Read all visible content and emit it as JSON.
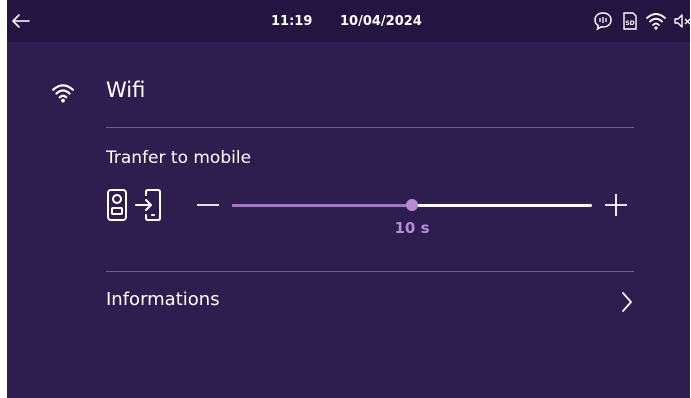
{
  "status_bar": {
    "time": "11:19",
    "date": "10/04/2024",
    "icons": [
      "back-arrow-icon",
      "intercom-icon",
      "sd-card-icon",
      "wifi-icon",
      "speaker-muted-icon"
    ]
  },
  "header": {
    "title": "Wifi",
    "icon": "wifi-icon"
  },
  "transfer": {
    "label": "Tranfer to mobile",
    "icons": [
      "doorbell-device-icon",
      "transfer-to-phone-icon"
    ],
    "slider": {
      "value_label": "10 s",
      "fill_fraction": 0.5
    }
  },
  "info": {
    "label": "Informations"
  },
  "colors": {
    "background": "#2e1e50",
    "status_bar": "#231441",
    "accent": "#b98ad6",
    "divider": "#6d5d8c",
    "text": "#ffffff"
  }
}
